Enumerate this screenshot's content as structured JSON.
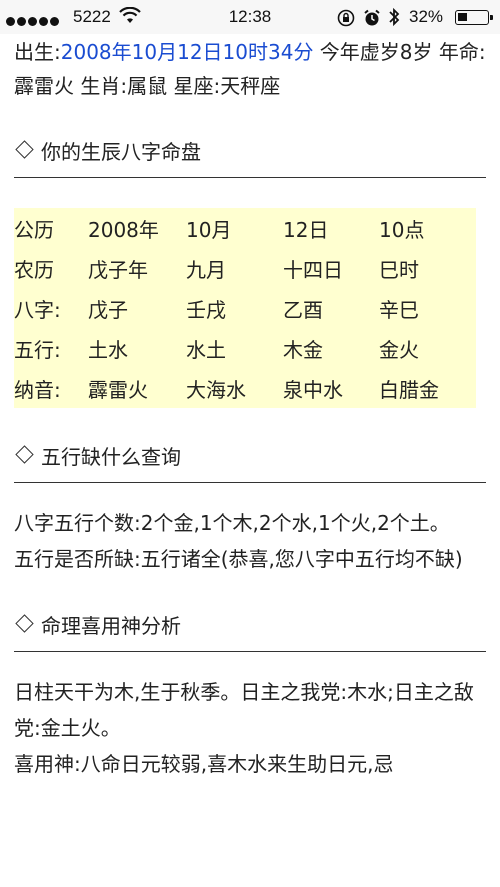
{
  "status_bar": {
    "carrier": "5222",
    "time": "12:38",
    "battery_pct": "32%",
    "battery_level": 0.32
  },
  "birth_info": {
    "label": "出生:",
    "datetime": "2008年10月12日10时34分",
    "age": " 今年虚岁8岁 年命:霹雷火 生肖:属鼠 星座:天秤座"
  },
  "sections": {
    "bazi_title": "你的生辰八字命盘",
    "wuxing_title": "五行缺什么查询",
    "analysis_title": "命理喜用神分析"
  },
  "bazi_table": [
    [
      "公历",
      "2008年",
      "10月",
      "12日",
      "10点"
    ],
    [
      "农历",
      "戊子年",
      "九月",
      "十四日",
      "巳时"
    ],
    [
      "八字:",
      "戊子",
      "壬戌",
      "乙酉",
      "辛巳"
    ],
    [
      "五行:",
      "土水",
      "水土",
      "木金",
      "金火"
    ],
    [
      "纳音:",
      "霹雷火",
      "大海水",
      "泉中水",
      "白腊金"
    ]
  ],
  "wuxing": {
    "count_text": "八字五行个数:2个金,1个木,2个水,1个火,2个土。",
    "missing_text": "五行是否所缺:五行诸全(恭喜,您八字中五行均不缺)"
  },
  "analysis": {
    "line1": "日柱天干为木,生于秋季。日主之我党:木水;日主之敌党:金土火。",
    "line2": "喜用神:八命日元较弱,喜木水来生助日元,忌"
  }
}
